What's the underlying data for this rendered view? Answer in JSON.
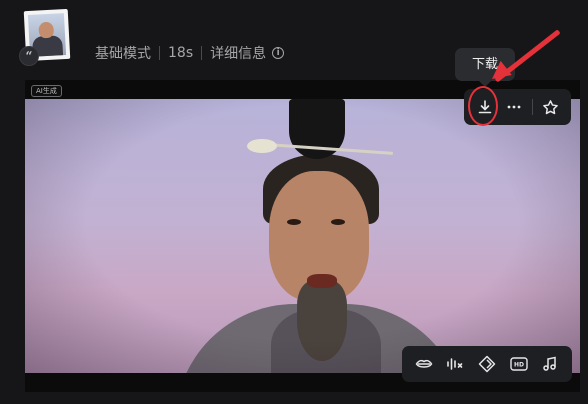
{
  "header": {
    "mode": "基础模式",
    "duration": "18s",
    "details": "详细信息",
    "quote_badge": "“"
  },
  "video": {
    "ai_badge": "AI生成"
  },
  "tooltip": {
    "label": "下载"
  },
  "toolbar": {
    "buttons": [
      {
        "name": "download",
        "icon": "download-icon"
      },
      {
        "name": "more",
        "icon": "more-icon"
      },
      {
        "name": "favorite",
        "icon": "star-icon"
      }
    ]
  },
  "bottom_toolbar": {
    "buttons": [
      {
        "name": "lip-sync",
        "icon": "lips-icon"
      },
      {
        "name": "audio",
        "icon": "audio-wave-icon"
      },
      {
        "name": "frames",
        "icon": "diamond-icon"
      },
      {
        "name": "hd",
        "icon": "hd-icon",
        "label": "HD"
      },
      {
        "name": "music",
        "icon": "music-note-icon"
      }
    ]
  },
  "colors": {
    "background": "#161618",
    "toolbar": "#1e1f22",
    "annotation_red": "#e5323a",
    "text_muted": "#a5a5aa"
  }
}
